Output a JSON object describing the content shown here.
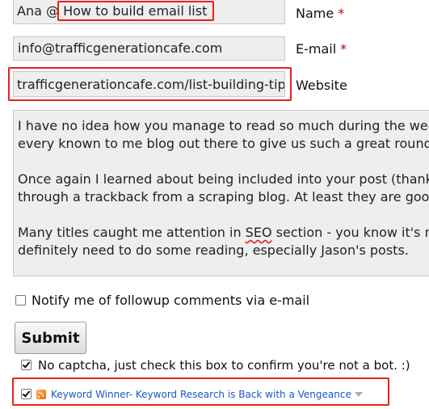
{
  "form": {
    "name_field": {
      "prefix": "Ana @",
      "keywords": "How to build email list"
    },
    "name_label": "Name",
    "email_value": "info@trafficgenerationcafe.com",
    "email_label": "E-mail",
    "required_marker": "*",
    "website_value": "trafficgenerationcafe.com/list-building-tips/",
    "website_label": "Website"
  },
  "comment": {
    "line1": "I have no idea how you manage to read so much during the week, and",
    "line2": "every known to me blog out there to give us such a great roundup of",
    "line3": "Once again I learned about being included into your post (thank you!",
    "line4": "through a trackback from a scraping blog. At least they are good for",
    "line5_before": "Many titles caught me attention in ",
    "line5_misspelled": "SEO",
    "line5_after": " section - you know it's my pet",
    "line6": "definitely need to do some reading, especially Jason's posts."
  },
  "notify": {
    "label": "Notify me of followup comments via e-mail",
    "checked": false
  },
  "submit_label": "Submit",
  "captcha": {
    "label": "No captcha, just check this box to confirm you're not a bot. :)",
    "checked": true
  },
  "commentluv": {
    "link_text": "Keyword Winner- Keyword Research is Back with a Vengeance",
    "checked": true,
    "icons": [
      "rss-icon",
      "caret-down-icon"
    ]
  },
  "colors": {
    "highlight": "#e8211e",
    "link": "#1a57c2",
    "required": "#c00000",
    "field_bg": "#eeeeee"
  }
}
